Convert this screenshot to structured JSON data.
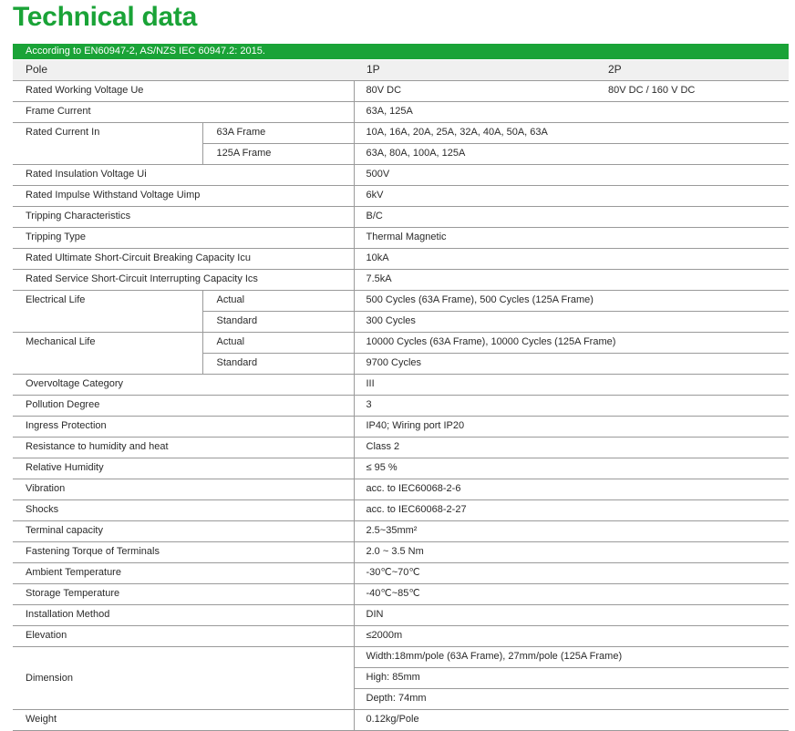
{
  "title": "Technical data",
  "banner": "According to EN60947-2, AS/NZS IEC 60947.2: 2015.",
  "header": {
    "param": "Pole",
    "col1": "1P",
    "col2": "2P"
  },
  "rows": {
    "working_voltage": {
      "label": "Rated Working Voltage   Ue",
      "v1": "80V DC",
      "v2": "80V DC / 160 V DC"
    },
    "frame_current": {
      "label": "Frame Current",
      "value": "63A, 125A"
    },
    "rated_current": {
      "label": "Rated Current In",
      "sub1": "63A Frame",
      "val1": "10A, 16A, 20A, 25A, 32A, 40A, 50A, 63A",
      "sub2": "125A Frame",
      "val2": "63A, 80A, 100A, 125A"
    },
    "insulation_voltage": {
      "label": "Rated Insulation Voltage Ui",
      "value": "500V"
    },
    "impulse_voltage": {
      "label": "Rated Impulse Withstand Voltage  Uimp",
      "value": "6kV"
    },
    "tripping_characteristics": {
      "label": "Tripping Characteristics",
      "value": "B/C"
    },
    "tripping_type": {
      "label": "Tripping Type",
      "value": "Thermal Magnetic"
    },
    "icu": {
      "label": "Rated Ultimate Short-Circuit Breaking Capacity Icu",
      "value": "10kA"
    },
    "ics": {
      "label": "Rated Service Short-Circuit Interrupting Capacity Ics",
      "value": "7.5kA"
    },
    "electrical_life": {
      "label": "Electrical Life",
      "sub1": "Actual",
      "val1": "500 Cycles (63A Frame), 500 Cycles (125A Frame)",
      "sub2": "Standard",
      "val2": "300 Cycles"
    },
    "mechanical_life": {
      "label": "Mechanical Life",
      "sub1": "Actual",
      "val1": "10000 Cycles (63A Frame), 10000 Cycles (125A Frame)",
      "sub2": "Standard",
      "val2": "9700 Cycles"
    },
    "overvoltage": {
      "label": "Overvoltage Category",
      "value": "III"
    },
    "pollution": {
      "label": "Pollution Degree",
      "value": "3"
    },
    "ingress": {
      "label": "Ingress Protection",
      "value": "IP40; Wiring port IP20"
    },
    "humidity_heat": {
      "label": "Resistance to humidity and heat",
      "value": "Class 2"
    },
    "relative_humidity": {
      "label": "Relative Humidity",
      "value": "≤ 95 %"
    },
    "vibration": {
      "label": "Vibration",
      "value": "acc. to IEC60068-2-6"
    },
    "shocks": {
      "label": "Shocks",
      "value": "acc. to IEC60068-2-27"
    },
    "terminal_capacity": {
      "label": "Terminal capacity",
      "value": "2.5~35mm²"
    },
    "torque": {
      "label": "Fastening Torque of Terminals",
      "value": "2.0 ~ 3.5 Nm"
    },
    "ambient_temp": {
      "label": "Ambient Temperature",
      "value": "-30℃~70℃"
    },
    "storage_temp": {
      "label": "Storage Temperature",
      "value": "-40℃~85℃"
    },
    "installation": {
      "label": "Installation Method",
      "value": "DIN"
    },
    "elevation": {
      "label": "Elevation",
      "value": "≤2000m"
    },
    "dimension": {
      "label": "Dimension",
      "width": "Width:18mm/pole (63A Frame), 27mm/pole (125A Frame)",
      "high": "High: 85mm",
      "depth": "Depth: 74mm"
    },
    "weight": {
      "label": "Weight",
      "value": "0.12kg/Pole"
    }
  }
}
